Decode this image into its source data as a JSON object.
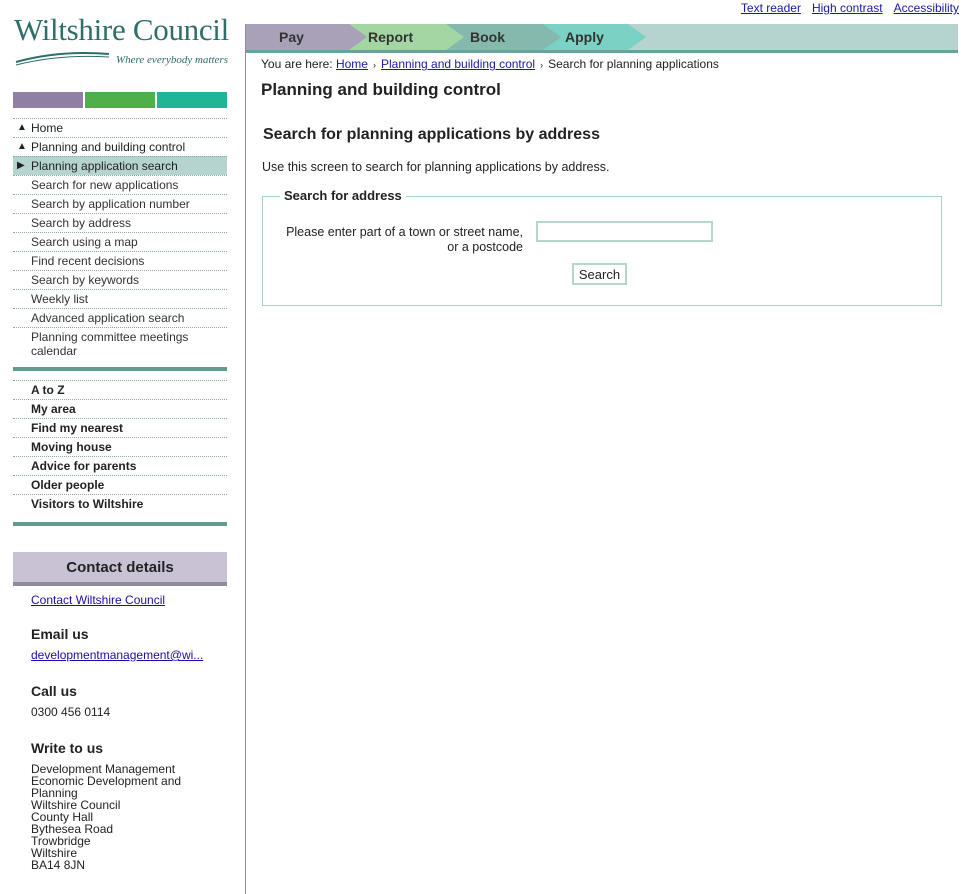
{
  "accessibility": [
    "Text reader",
    "High contrast",
    "Accessibility"
  ],
  "logo": {
    "title": "Wiltshire Council",
    "tagline": "Where everybody matters"
  },
  "colors": {
    "purple": "#8e7fa3",
    "green": "#4db04a",
    "teal": "#1fb596"
  },
  "tabs": [
    {
      "label": "Pay",
      "color": "#a8a1b8"
    },
    {
      "label": "Report",
      "color": "#a3d6a2"
    },
    {
      "label": "Book",
      "color": "#86b9ad"
    },
    {
      "label": "Apply",
      "color": "#7bd1c4"
    }
  ],
  "nav": [
    {
      "label": "Home",
      "marker": "▲"
    },
    {
      "label": "Planning and building control",
      "marker": "▲"
    },
    {
      "label": "Planning application search",
      "marker": "▶",
      "active": true
    },
    {
      "label": "Search for new applications"
    },
    {
      "label": "Search by application number"
    },
    {
      "label": "Search by address"
    },
    {
      "label": "Search using a map"
    },
    {
      "label": "Find recent decisions"
    },
    {
      "label": "Search by keywords"
    },
    {
      "label": "Weekly list"
    },
    {
      "label": "Advanced application search"
    },
    {
      "label": "Planning committee meetings calendar"
    }
  ],
  "nav2": [
    "A to Z",
    "My area",
    "Find my nearest",
    "Moving house",
    "Advice for parents",
    "Older people",
    "Visitors to Wiltshire"
  ],
  "contact": {
    "heading": "Contact details",
    "link": "Contact Wiltshire Council",
    "email_heading": "Email us",
    "email": "developmentmanagement@wi...",
    "call_heading": "Call us",
    "phone": "0300 456 0114",
    "write_heading": "Write to us",
    "address": [
      "Development Management",
      "Economic Development and Planning",
      "Wiltshire Council",
      "County Hall",
      "Bythesea Road",
      "Trowbridge",
      "Wiltshire",
      "BA14 8JN"
    ]
  },
  "breadcrumb": {
    "prefix": "You are here:",
    "links": [
      "Home",
      "Planning and building control"
    ],
    "current": "Search for planning applications"
  },
  "main": {
    "title": "Planning and building control",
    "subtitle": "Search for planning applications by address",
    "intro": "Use this screen to search for planning applications by address.",
    "legend": "Search for address",
    "label": "Please enter part of a town or street name, or a postcode",
    "input_value": "",
    "search_button": "Search"
  }
}
